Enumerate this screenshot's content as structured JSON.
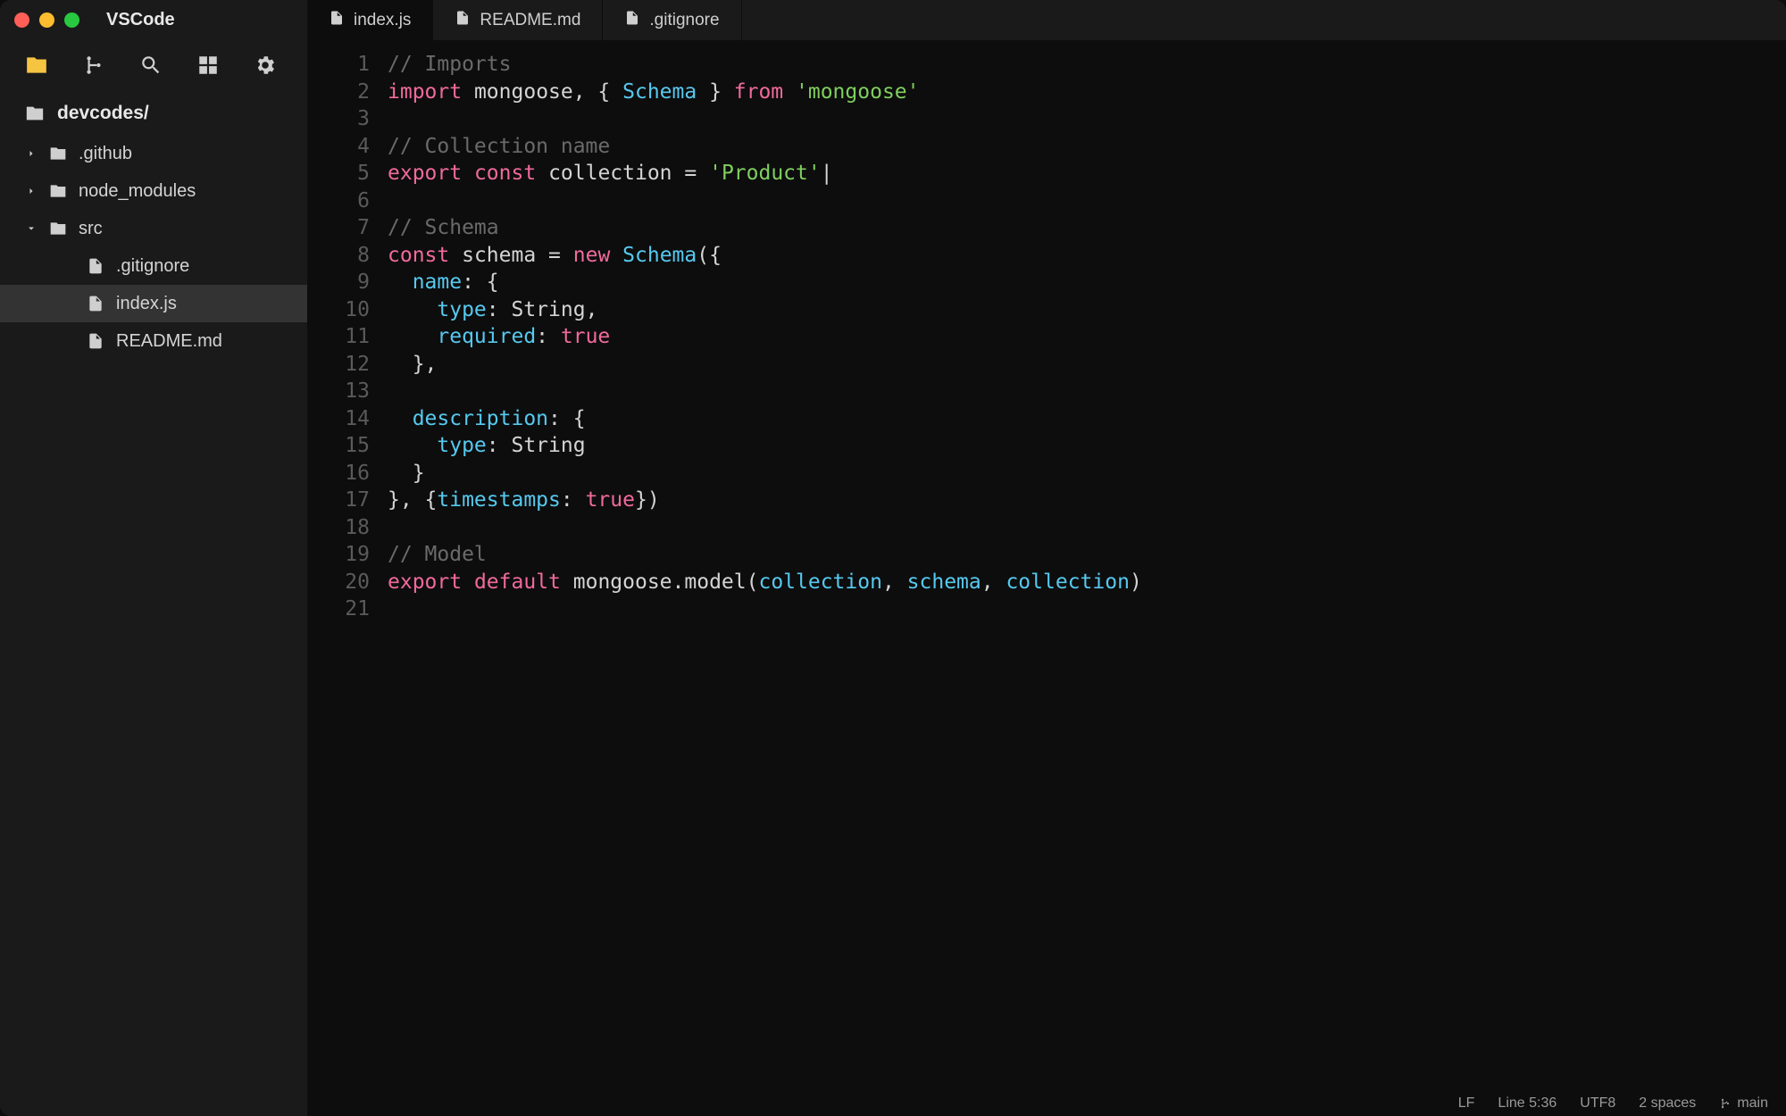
{
  "app": {
    "title": "VSCode"
  },
  "sidebar": {
    "project": "devcodes/",
    "items": [
      {
        "label": ".github",
        "type": "folder",
        "expanded": false,
        "depth": 1
      },
      {
        "label": "node_modules",
        "type": "folder",
        "expanded": false,
        "depth": 1
      },
      {
        "label": "src",
        "type": "folder",
        "expanded": true,
        "depth": 1
      },
      {
        "label": ".gitignore",
        "type": "file",
        "depth": 2
      },
      {
        "label": "index.js",
        "type": "file",
        "depth": 2,
        "active": true
      },
      {
        "label": "README.md",
        "type": "file",
        "depth": 2
      }
    ]
  },
  "tabs": [
    {
      "label": "index.js",
      "icon": "js",
      "active": true
    },
    {
      "label": "README.md",
      "icon": "md",
      "active": false
    },
    {
      "label": ".gitignore",
      "icon": "file",
      "active": false
    }
  ],
  "code": {
    "lines": [
      [
        {
          "c": "comment",
          "t": "// Imports"
        }
      ],
      [
        {
          "c": "keyword",
          "t": "import"
        },
        {
          "c": "punc",
          "t": " "
        },
        {
          "c": "ident",
          "t": "mongoose"
        },
        {
          "c": "punc",
          "t": ", { "
        },
        {
          "c": "class",
          "t": "Schema"
        },
        {
          "c": "punc",
          "t": " } "
        },
        {
          "c": "keyword",
          "t": "from"
        },
        {
          "c": "punc",
          "t": " "
        },
        {
          "c": "string",
          "t": "'mongoose'"
        }
      ],
      [],
      [
        {
          "c": "comment",
          "t": "// Collection name"
        }
      ],
      [
        {
          "c": "keyword",
          "t": "export"
        },
        {
          "c": "punc",
          "t": " "
        },
        {
          "c": "keyword",
          "t": "const"
        },
        {
          "c": "punc",
          "t": " "
        },
        {
          "c": "ident",
          "t": "collection"
        },
        {
          "c": "punc",
          "t": " = "
        },
        {
          "c": "string",
          "t": "'Product'"
        },
        {
          "c": "cursor",
          "t": "|"
        }
      ],
      [],
      [
        {
          "c": "comment",
          "t": "// Schema"
        }
      ],
      [
        {
          "c": "keyword",
          "t": "const"
        },
        {
          "c": "punc",
          "t": " "
        },
        {
          "c": "ident",
          "t": "schema"
        },
        {
          "c": "punc",
          "t": " = "
        },
        {
          "c": "keyword",
          "t": "new"
        },
        {
          "c": "punc",
          "t": " "
        },
        {
          "c": "class",
          "t": "Schema"
        },
        {
          "c": "punc",
          "t": "({"
        }
      ],
      [
        {
          "c": "punc",
          "t": "  "
        },
        {
          "c": "prop2",
          "t": "name"
        },
        {
          "c": "punc",
          "t": ": {"
        }
      ],
      [
        {
          "c": "punc",
          "t": "    "
        },
        {
          "c": "prop2",
          "t": "type"
        },
        {
          "c": "punc",
          "t": ": "
        },
        {
          "c": "ident",
          "t": "String"
        },
        {
          "c": "punc",
          "t": ","
        }
      ],
      [
        {
          "c": "punc",
          "t": "    "
        },
        {
          "c": "prop2",
          "t": "required"
        },
        {
          "c": "punc",
          "t": ": "
        },
        {
          "c": "bool",
          "t": "true"
        }
      ],
      [
        {
          "c": "punc",
          "t": "  },"
        }
      ],
      [],
      [
        {
          "c": "punc",
          "t": "  "
        },
        {
          "c": "prop2",
          "t": "description"
        },
        {
          "c": "punc",
          "t": ": {"
        }
      ],
      [
        {
          "c": "punc",
          "t": "    "
        },
        {
          "c": "prop2",
          "t": "type"
        },
        {
          "c": "punc",
          "t": ": "
        },
        {
          "c": "ident",
          "t": "String"
        }
      ],
      [
        {
          "c": "punc",
          "t": "  }"
        }
      ],
      [
        {
          "c": "punc",
          "t": "}, {"
        },
        {
          "c": "prop2",
          "t": "timestamps"
        },
        {
          "c": "punc",
          "t": ": "
        },
        {
          "c": "bool",
          "t": "true"
        },
        {
          "c": "punc",
          "t": "})"
        }
      ],
      [],
      [
        {
          "c": "comment",
          "t": "// Model"
        }
      ],
      [
        {
          "c": "keyword",
          "t": "export"
        },
        {
          "c": "punc",
          "t": " "
        },
        {
          "c": "keyword",
          "t": "default"
        },
        {
          "c": "punc",
          "t": " "
        },
        {
          "c": "ident",
          "t": "mongoose.model("
        },
        {
          "c": "param",
          "t": "collection"
        },
        {
          "c": "punc",
          "t": ", "
        },
        {
          "c": "param",
          "t": "schema"
        },
        {
          "c": "punc",
          "t": ", "
        },
        {
          "c": "param",
          "t": "collection"
        },
        {
          "c": "punc",
          "t": ")"
        }
      ],
      []
    ]
  },
  "statusbar": {
    "eol": "LF",
    "position": "Line 5:36",
    "encoding": "UTF8",
    "indent": "2 spaces",
    "branch": "main"
  }
}
